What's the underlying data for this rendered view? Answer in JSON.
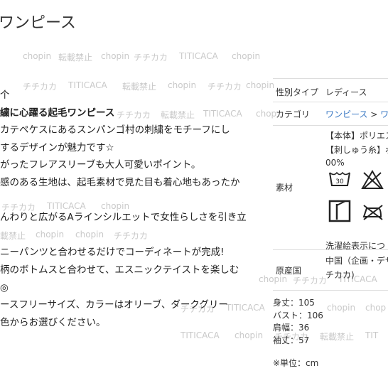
{
  "title": "ワンピース",
  "description": {
    "lines": [
      "个",
      "繍に心躍る起毛ワンピース",
      "カテペケスにあるスンパンゴ村の刺繍をモチーフにし",
      "するデザインが魅力です☆",
      "がったフレアスリーブも大人可愛いポイント。",
      "感のある生地は、起毛素材で見た目も着心地もあったか",
      "",
      "んわりと広がるAラインシルエットで女性らしさを引き立",
      "",
      "ニーパンツと合わせるだけでコーディネートが完成!",
      "柄のボトムスと合わせて、エスニックテイストを楽しむ",
      "◎",
      "ースフリーサイズ、カラーはオリーブ、ダークグリー",
      "色からお選びください。"
    ]
  },
  "spec": {
    "gender_label": "性別タイプ",
    "gender_value": "レディース",
    "category_label": "カテゴリ",
    "category_link": "ワンピース",
    "category_sep": ">",
    "category_next": "ワ",
    "material_label": "素材",
    "material_line1": "【本体】ポリエス",
    "material_line2": "【刺しゅう糸】ボ",
    "material_line3": "00%",
    "wash_temp": "30",
    "wash_link": "洗濯絵表示につ",
    "origin_label": "原産国",
    "origin_line1": "中国（企画・デザ",
    "origin_line2": "チカカ)"
  },
  "sizes": [
    "身丈：105",
    "バスト：106",
    "肩幅：36",
    "袖丈：57"
  ],
  "unit_note": "※単位：cm",
  "watermark_text": {
    "w1": "chopin",
    "w2": "転載禁止",
    "w3": "chopin",
    "w4": "チチカカ",
    "w5": "TITICACA",
    "w6": "chopin",
    "w7": "チチカカ",
    "w8": "TITICACA",
    "w9": "転載禁止",
    "w10": "chopin",
    "w11": "チチカカ",
    "w12": "chopin",
    "w13": "チチカカ",
    "w14": "転載禁止",
    "w15": "TITICACA",
    "w16": "chop",
    "w17": "チチカカ",
    "w18": "TITICACA",
    "w19": "chopin",
    "w20": "載禁止",
    "w21": "chopin",
    "w22": "chopin",
    "w23": "チチカカ",
    "w24": "chopin",
    "w25": "チチカカ",
    "w26": "TITICACA",
    "w27": "チチカカ",
    "w28": "TITICACA",
    "w29": "chopin",
    "w30": "chop",
    "w31": "TITICACA",
    "w32": "chopin",
    "w33": "チチカカ",
    "w34": "転載禁止",
    "w35": "TIT"
  }
}
